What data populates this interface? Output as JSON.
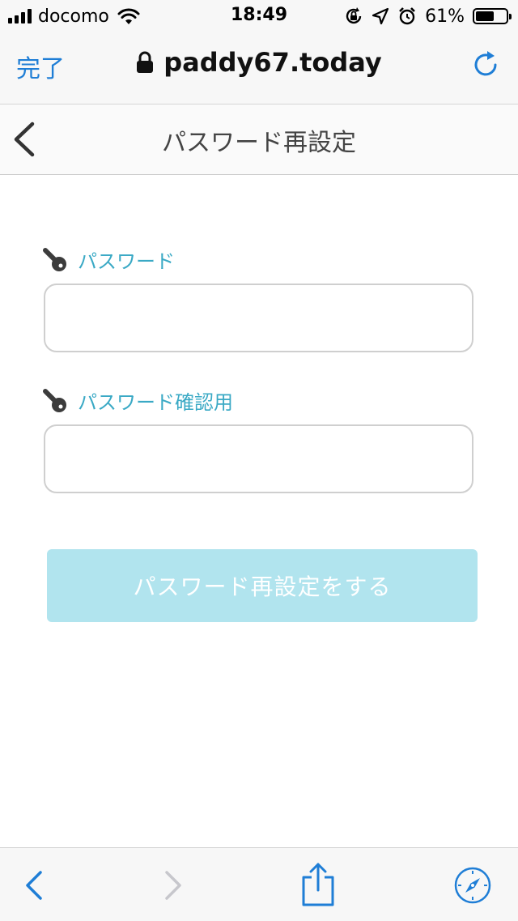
{
  "status_bar": {
    "carrier": "docomo",
    "time": "18:49",
    "battery_percent": "61%",
    "battery_level": 0.61,
    "icons": [
      "signal-icon",
      "wifi-icon",
      "orientation-lock-icon",
      "location-arrow-icon",
      "alarm-icon",
      "battery-icon"
    ]
  },
  "browser": {
    "done_label": "完了",
    "url": "paddy67.today",
    "icons": [
      "lock-icon",
      "reload-icon"
    ],
    "accent_color": "#1f7ed6"
  },
  "page": {
    "title": "パスワード再設定",
    "back_icon": "chevron-left-icon"
  },
  "form": {
    "password_label": "パスワード",
    "password_value": "",
    "confirm_label": "パスワード確認用",
    "confirm_value": "",
    "label_icon": "key-icon",
    "label_color": "#3aa9c5",
    "submit_label": "パスワード再設定をする",
    "submit_color": "#b1e4ee"
  },
  "toolbar": {
    "icons": [
      "back-arrow-icon",
      "forward-arrow-icon",
      "share-icon",
      "compass-icon"
    ]
  }
}
